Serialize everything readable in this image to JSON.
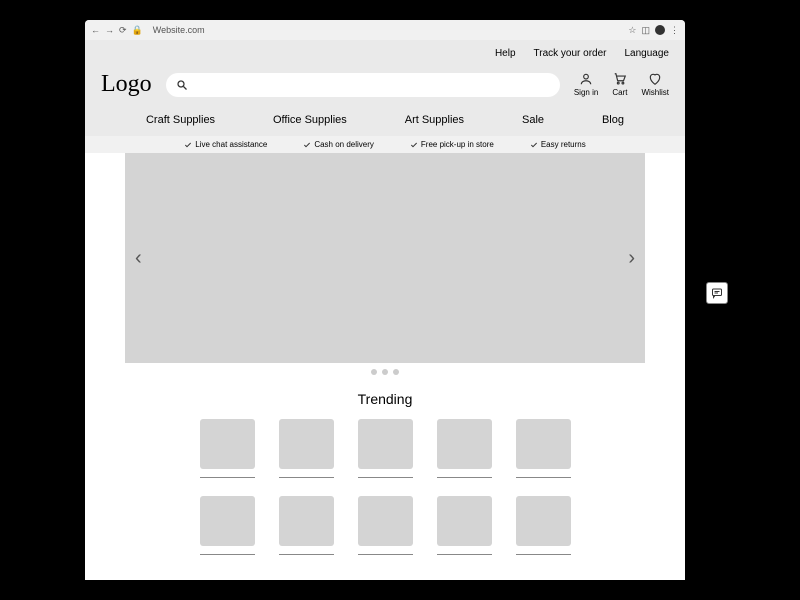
{
  "browser": {
    "url": "Website.com",
    "menu_dots": "⋮"
  },
  "top_links": {
    "help": "Help",
    "track": "Track your order",
    "language": "Language"
  },
  "logo": "Logo",
  "search": {
    "placeholder": ""
  },
  "header_actions": {
    "signin": "Sign in",
    "cart": "Cart",
    "wishlist": "Wishlist"
  },
  "nav": {
    "craft": "Craft Supplies",
    "office": "Office Supplies",
    "art": "Art Supplies",
    "sale": "Sale",
    "blog": "Blog"
  },
  "benefits": {
    "chat": "Live chat assistance",
    "cod": "Cash on delivery",
    "pickup": "Free pick-up in store",
    "returns": "Easy returns"
  },
  "trending": {
    "title": "Trending"
  }
}
